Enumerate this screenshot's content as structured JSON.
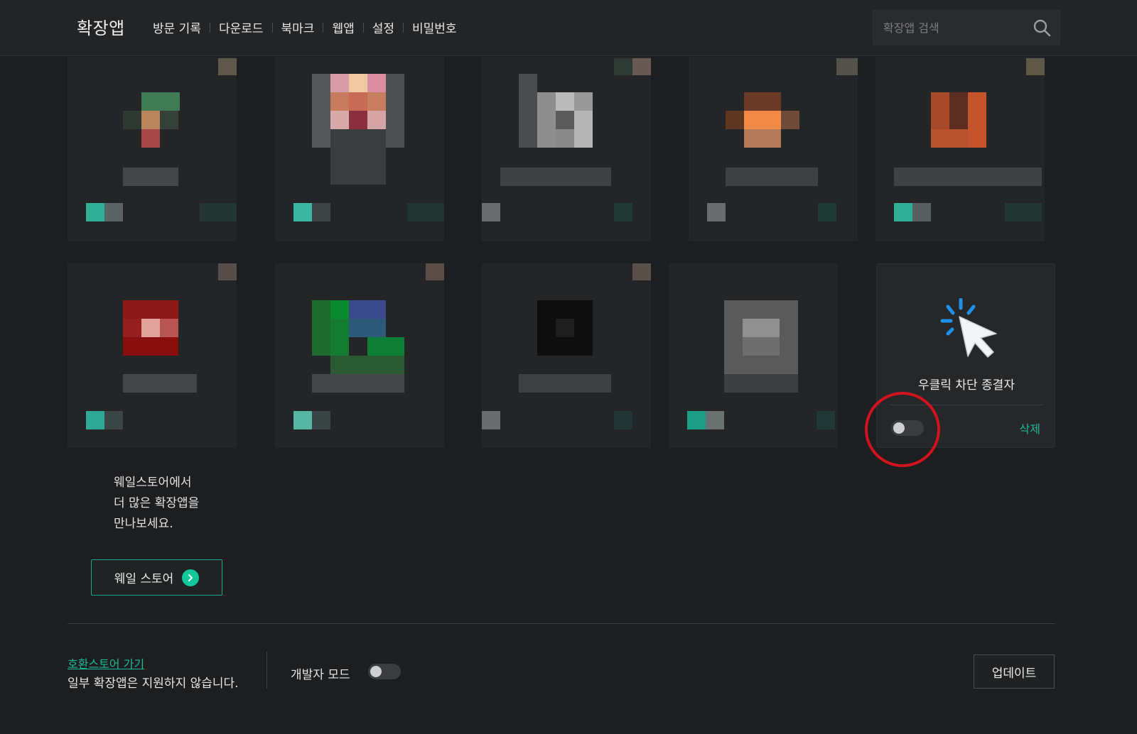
{
  "header": {
    "title": "확장앱",
    "nav": [
      "방문 기록",
      "다운로드",
      "북마크",
      "웹앱",
      "설정",
      "비밀번호"
    ],
    "search_placeholder": "확장앱 검색"
  },
  "active_card": {
    "name": "우클릭 차단 종결자",
    "delete_label": "삭제",
    "enabled": false,
    "icon": "cursor-click-icon"
  },
  "promo": {
    "lines": [
      "웨일스토어에서",
      "더 많은 확장앱을",
      "만나보세요."
    ],
    "button_label": "웨일 스토어"
  },
  "footer": {
    "compat_link": "호환스토어 가기",
    "compat_note": "일부 확장앱은 지원하지 않습니다.",
    "dev_mode_label": "개발자 모드",
    "dev_mode_enabled": false,
    "update_label": "업데이트"
  },
  "colors": {
    "accent": "#1fb89a",
    "highlight": "#d0141f",
    "background": "#1c1e20"
  }
}
